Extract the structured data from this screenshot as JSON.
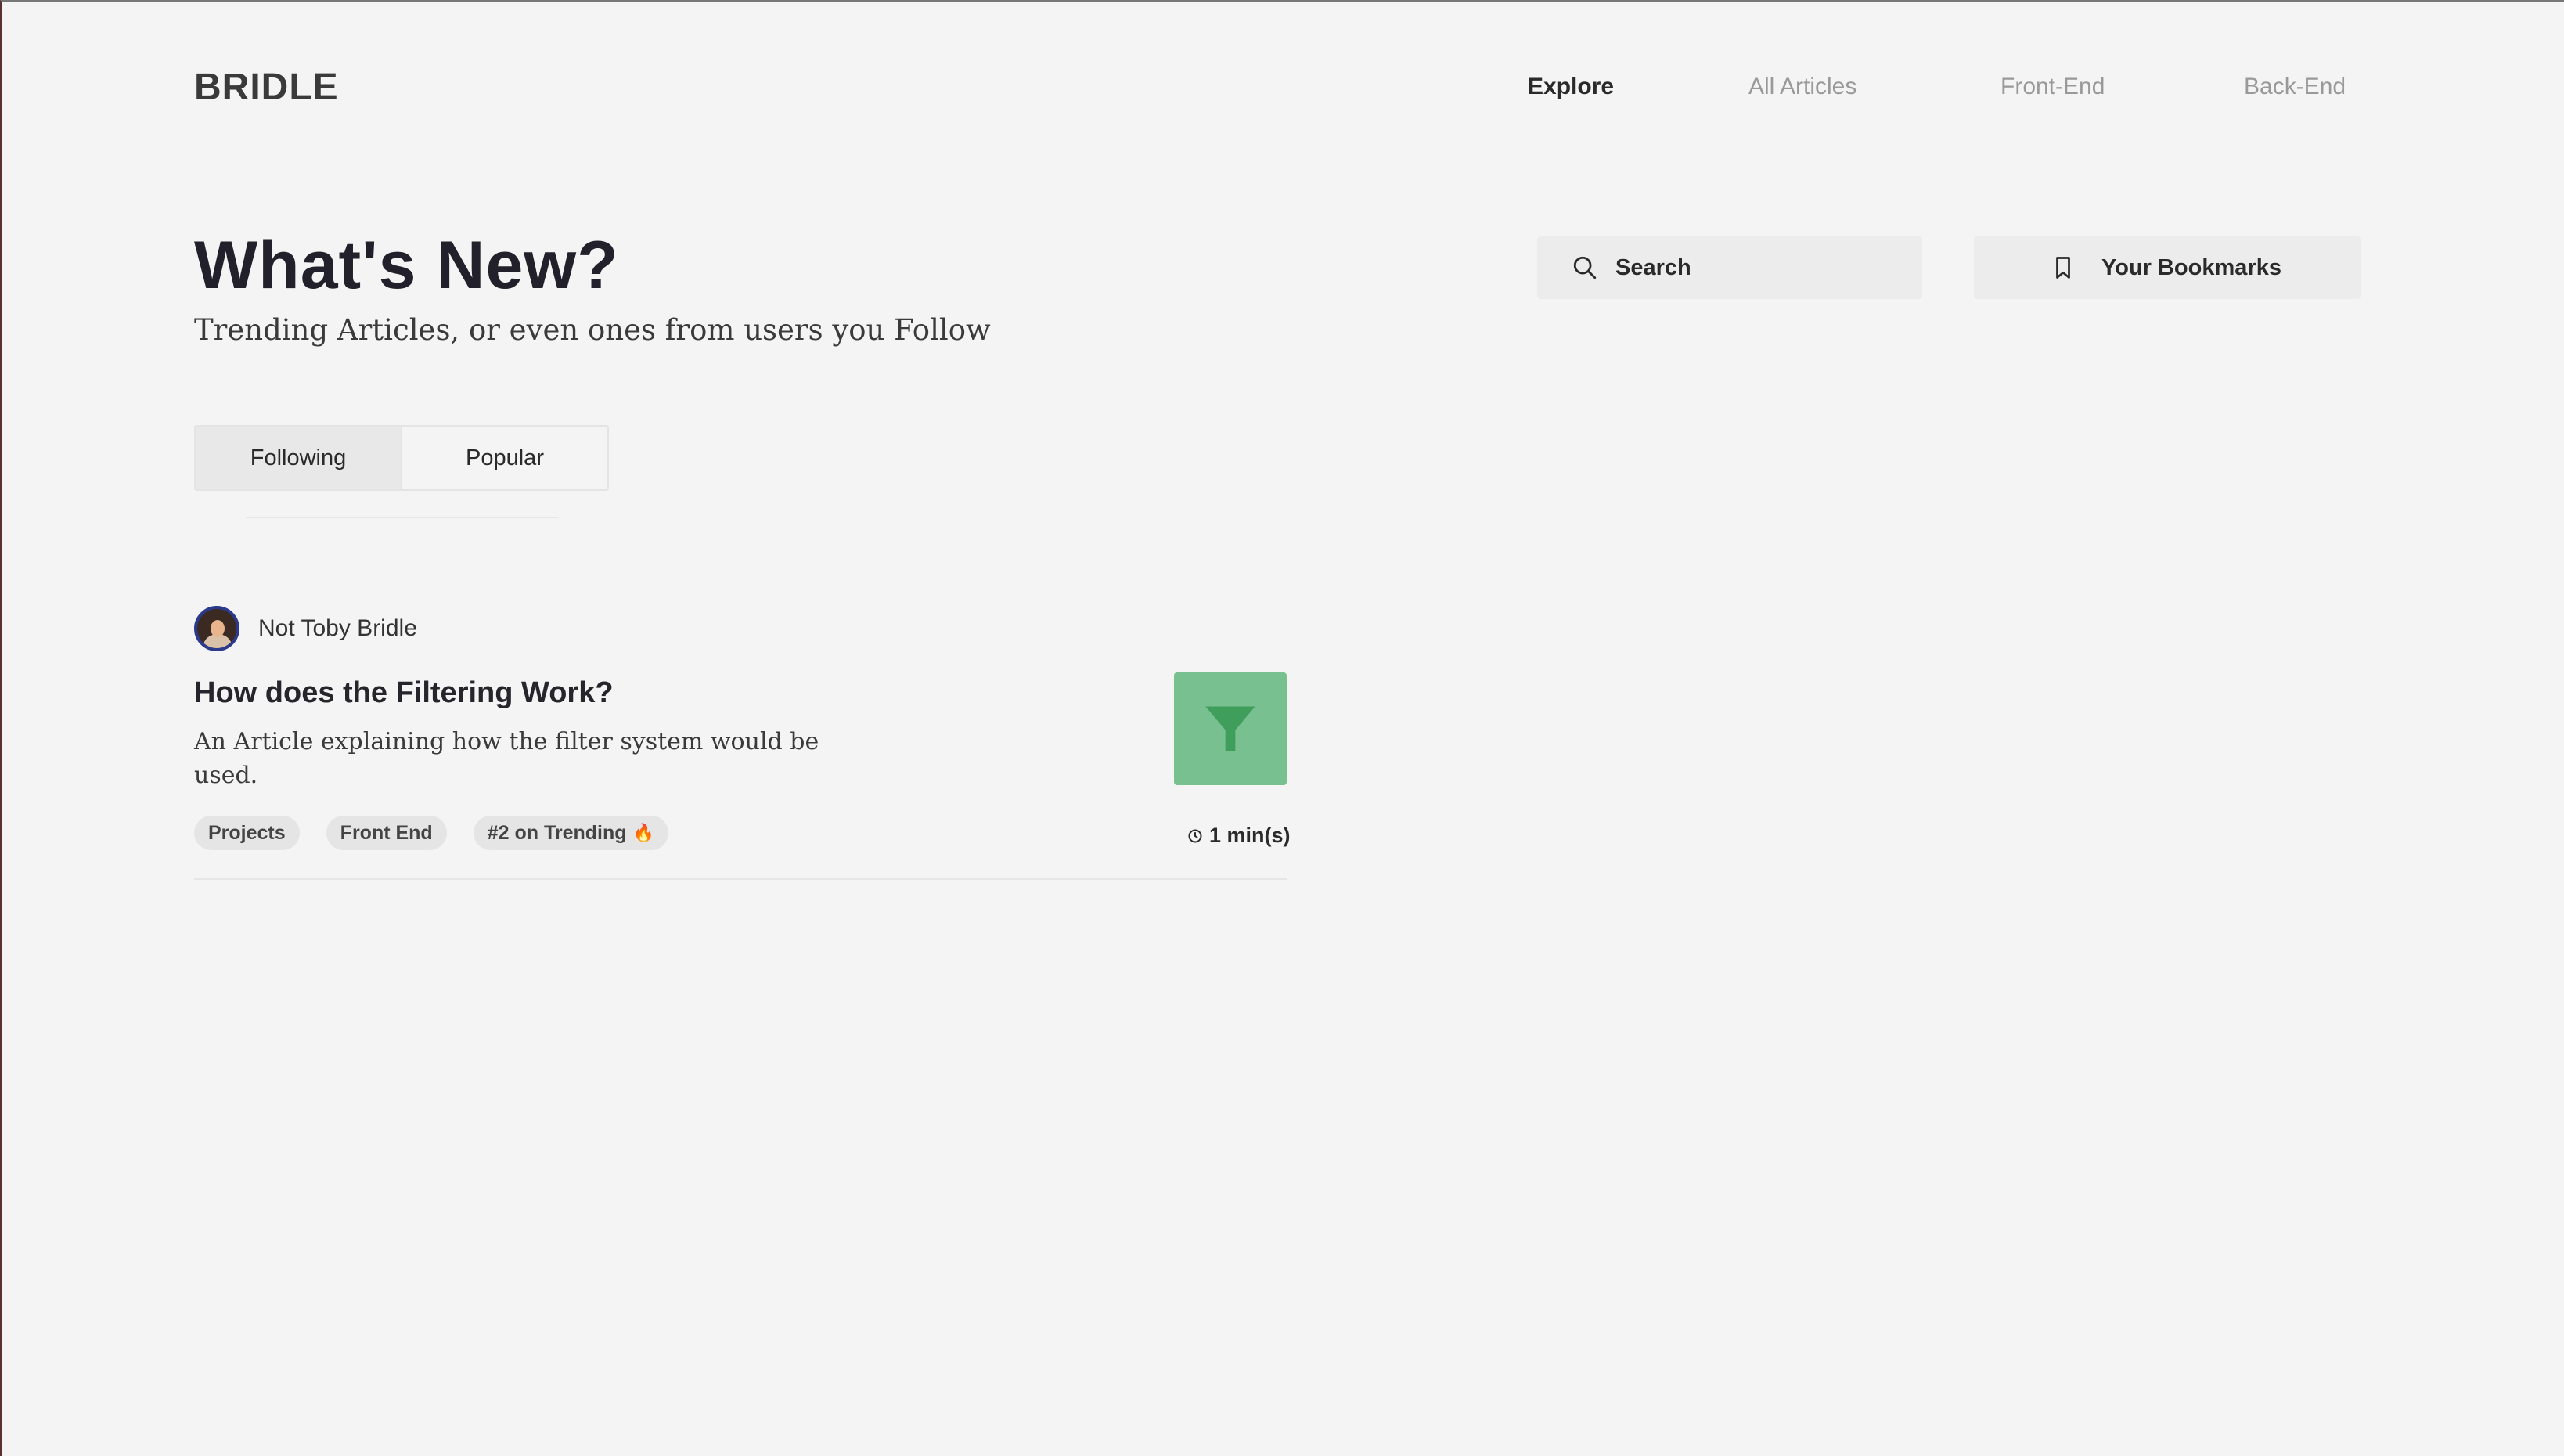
{
  "header": {
    "logo": "BRIDLE",
    "nav": [
      {
        "label": "Explore",
        "active": true
      },
      {
        "label": "All Articles",
        "active": false
      },
      {
        "label": "Front-End",
        "active": false
      },
      {
        "label": "Back-End",
        "active": false
      }
    ]
  },
  "hero": {
    "title": "What's New?",
    "subtitle": "Trending Articles, or even ones from users you Follow"
  },
  "search": {
    "placeholder": "Search"
  },
  "bookmarks": {
    "label": "Your Bookmarks"
  },
  "feed_toggle": {
    "options": [
      {
        "label": "Following",
        "selected": true
      },
      {
        "label": "Popular",
        "selected": false
      }
    ]
  },
  "articles": [
    {
      "author": "Not Toby Bridle",
      "title": "How does the Filtering Work?",
      "description": "An Article explaining how the filter system would be used.",
      "tags": [
        "Projects",
        "Front End",
        "#2 on Trending"
      ],
      "trending_emoji": "🔥",
      "read_time": "1 min(s)",
      "thumbnail_icon": "filter-icon",
      "thumbnail_color": "#78c08f"
    }
  ],
  "colors": {
    "background": "#f4f4f4",
    "accent_green": "#78c08f",
    "icon_green": "#3f9e5c",
    "fire": "#e8631a"
  }
}
